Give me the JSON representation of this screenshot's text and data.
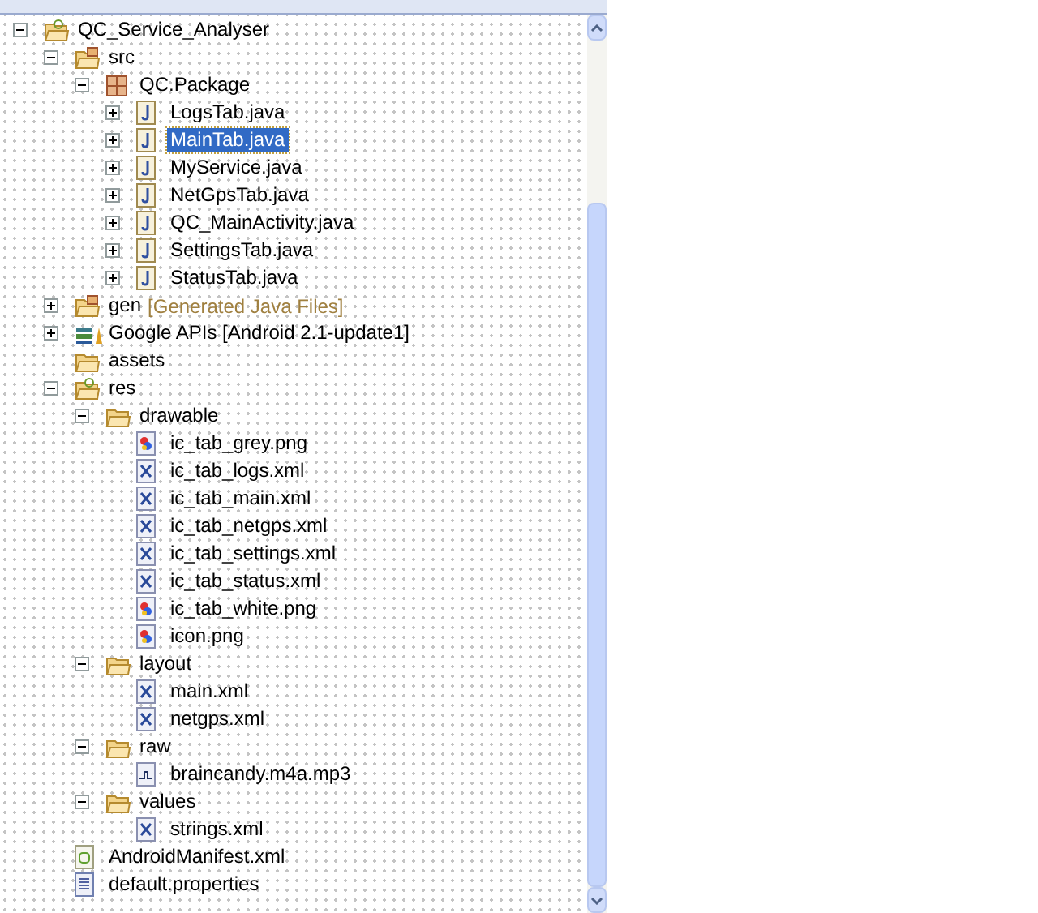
{
  "tree": [
    {
      "label": "QC_Service_Analyser",
      "kind": "project",
      "expanded": true,
      "selected": false,
      "children": [
        {
          "label": "src",
          "kind": "source-folder",
          "expanded": true,
          "selected": false,
          "children": [
            {
              "label": "QC.Package",
              "kind": "package",
              "expanded": true,
              "selected": false,
              "children": [
                {
                  "label": "LogsTab.java",
                  "kind": "java",
                  "expanded": false,
                  "selected": false
                },
                {
                  "label": "MainTab.java",
                  "kind": "java",
                  "expanded": false,
                  "selected": true
                },
                {
                  "label": "MyService.java",
                  "kind": "java",
                  "expanded": false,
                  "selected": false
                },
                {
                  "label": "NetGpsTab.java",
                  "kind": "java",
                  "expanded": false,
                  "selected": false
                },
                {
                  "label": "QC_MainActivity.java",
                  "kind": "java",
                  "expanded": false,
                  "selected": false
                },
                {
                  "label": "SettingsTab.java",
                  "kind": "java",
                  "expanded": false,
                  "selected": false
                },
                {
                  "label": "StatusTab.java",
                  "kind": "java",
                  "expanded": false,
                  "selected": false
                }
              ]
            }
          ]
        },
        {
          "label": "gen",
          "suffix": "[Generated Java Files]",
          "kind": "source-folder",
          "expanded": false,
          "selected": false
        },
        {
          "label": "Google APIs [Android 2.1-update1]",
          "kind": "library",
          "expanded": false,
          "selected": false
        },
        {
          "label": "assets",
          "kind": "folder",
          "selected": false
        },
        {
          "label": "res",
          "kind": "res-folder",
          "expanded": true,
          "selected": false,
          "children": [
            {
              "label": "drawable",
              "kind": "folder",
              "expanded": true,
              "selected": false,
              "children": [
                {
                  "label": "ic_tab_grey.png",
                  "kind": "image",
                  "selected": false
                },
                {
                  "label": "ic_tab_logs.xml",
                  "kind": "xml",
                  "selected": false
                },
                {
                  "label": "ic_tab_main.xml",
                  "kind": "xml",
                  "selected": false
                },
                {
                  "label": "ic_tab_netgps.xml",
                  "kind": "xml",
                  "selected": false
                },
                {
                  "label": "ic_tab_settings.xml",
                  "kind": "xml",
                  "selected": false
                },
                {
                  "label": "ic_tab_status.xml",
                  "kind": "xml",
                  "selected": false
                },
                {
                  "label": "ic_tab_white.png",
                  "kind": "image",
                  "selected": false
                },
                {
                  "label": "icon.png",
                  "kind": "image",
                  "selected": false
                }
              ]
            },
            {
              "label": "layout",
              "kind": "folder",
              "expanded": true,
              "selected": false,
              "children": [
                {
                  "label": "main.xml",
                  "kind": "xml",
                  "selected": false
                },
                {
                  "label": "netgps.xml",
                  "kind": "xml",
                  "selected": false
                }
              ]
            },
            {
              "label": "raw",
              "kind": "folder",
              "expanded": true,
              "selected": false,
              "children": [
                {
                  "label": "braincandy.m4a.mp3",
                  "kind": "audio",
                  "selected": false
                }
              ]
            },
            {
              "label": "values",
              "kind": "folder",
              "expanded": true,
              "selected": false,
              "children": [
                {
                  "label": "strings.xml",
                  "kind": "xml",
                  "selected": false
                }
              ]
            }
          ]
        },
        {
          "label": "AndroidManifest.xml",
          "kind": "manifest",
          "selected": false
        },
        {
          "label": "default.properties",
          "kind": "properties",
          "selected": false
        }
      ]
    }
  ]
}
